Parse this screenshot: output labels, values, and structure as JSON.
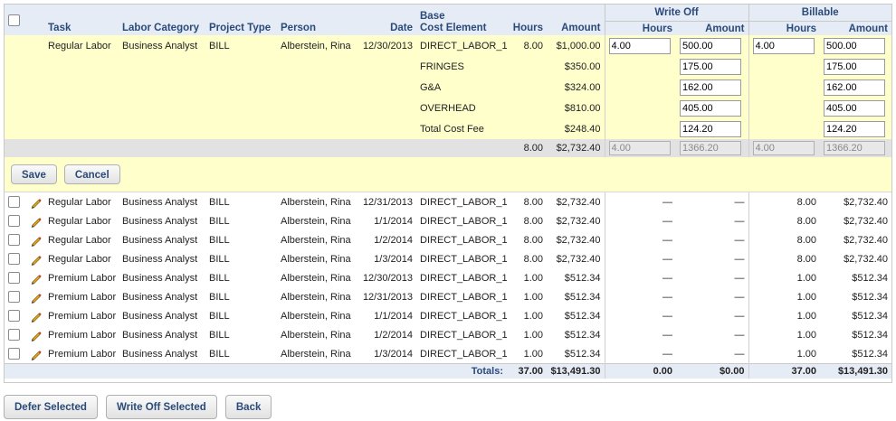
{
  "headers": {
    "task": "Task",
    "labor_category": "Labor Category",
    "project_type": "Project Type",
    "person": "Person",
    "date": "Date",
    "cost_element_1": "Base",
    "cost_element_2": "Cost Element",
    "hours": "Hours",
    "amount": "Amount",
    "write_off": "Write Off",
    "write_off_hours": "Hours",
    "write_off_amount": "Amount",
    "billable": "Billable",
    "billable_hours": "Hours",
    "billable_amount": "Amount"
  },
  "edit": {
    "task": "Regular Labor",
    "labor_category": "Business Analyst",
    "project_type": "BILL",
    "person": "Alberstein, Rina",
    "date": "12/30/2013",
    "rows": [
      {
        "cost_element": "DIRECT_LABOR_1",
        "hours": "8.00",
        "amount": "$1,000.00",
        "wo_hours": "4.00",
        "wo_amount": "500.00",
        "b_hours": "4.00",
        "b_amount": "500.00"
      },
      {
        "cost_element": "FRINGES",
        "hours": "",
        "amount": "$350.00",
        "wo_amount": "175.00",
        "b_amount": "175.00"
      },
      {
        "cost_element": "G&A",
        "hours": "",
        "amount": "$324.00",
        "wo_amount": "162.00",
        "b_amount": "162.00"
      },
      {
        "cost_element": "OVERHEAD",
        "hours": "",
        "amount": "$810.00",
        "wo_amount": "405.00",
        "b_amount": "405.00"
      },
      {
        "cost_element": "Total Cost Fee",
        "hours": "",
        "amount": "$248.40",
        "wo_amount": "124.20",
        "b_amount": "124.20"
      }
    ],
    "summary": {
      "hours": "8.00",
      "amount": "$2,732.40",
      "wo_hours": "4.00",
      "wo_amount": "1366.20",
      "b_hours": "4.00",
      "b_amount": "1366.20"
    },
    "save_label": "Save",
    "cancel_label": "Cancel"
  },
  "rows": [
    {
      "task": "Regular Labor",
      "labor_category": "Business Analyst",
      "project_type": "BILL",
      "person": "Alberstein, Rina",
      "date": "12/31/2013",
      "cost_element": "DIRECT_LABOR_1",
      "hours": "8.00",
      "amount": "$2,732.40",
      "wo_hours": "—",
      "wo_amount": "—",
      "b_hours": "8.00",
      "b_amount": "$2,732.40"
    },
    {
      "task": "Regular Labor",
      "labor_category": "Business Analyst",
      "project_type": "BILL",
      "person": "Alberstein, Rina",
      "date": "1/1/2014",
      "cost_element": "DIRECT_LABOR_1",
      "hours": "8.00",
      "amount": "$2,732.40",
      "wo_hours": "—",
      "wo_amount": "—",
      "b_hours": "8.00",
      "b_amount": "$2,732.40"
    },
    {
      "task": "Regular Labor",
      "labor_category": "Business Analyst",
      "project_type": "BILL",
      "person": "Alberstein, Rina",
      "date": "1/2/2014",
      "cost_element": "DIRECT_LABOR_1",
      "hours": "8.00",
      "amount": "$2,732.40",
      "wo_hours": "—",
      "wo_amount": "—",
      "b_hours": "8.00",
      "b_amount": "$2,732.40"
    },
    {
      "task": "Regular Labor",
      "labor_category": "Business Analyst",
      "project_type": "BILL",
      "person": "Alberstein, Rina",
      "date": "1/3/2014",
      "cost_element": "DIRECT_LABOR_1",
      "hours": "8.00",
      "amount": "$2,732.40",
      "wo_hours": "—",
      "wo_amount": "—",
      "b_hours": "8.00",
      "b_amount": "$2,732.40"
    },
    {
      "task": "Premium Labor",
      "labor_category": "Business Analyst",
      "project_type": "BILL",
      "person": "Alberstein, Rina",
      "date": "12/30/2013",
      "cost_element": "DIRECT_LABOR_1",
      "hours": "1.00",
      "amount": "$512.34",
      "wo_hours": "—",
      "wo_amount": "—",
      "b_hours": "1.00",
      "b_amount": "$512.34"
    },
    {
      "task": "Premium Labor",
      "labor_category": "Business Analyst",
      "project_type": "BILL",
      "person": "Alberstein, Rina",
      "date": "12/31/2013",
      "cost_element": "DIRECT_LABOR_1",
      "hours": "1.00",
      "amount": "$512.34",
      "wo_hours": "—",
      "wo_amount": "—",
      "b_hours": "1.00",
      "b_amount": "$512.34"
    },
    {
      "task": "Premium Labor",
      "labor_category": "Business Analyst",
      "project_type": "BILL",
      "person": "Alberstein, Rina",
      "date": "1/1/2014",
      "cost_element": "DIRECT_LABOR_1",
      "hours": "1.00",
      "amount": "$512.34",
      "wo_hours": "—",
      "wo_amount": "—",
      "b_hours": "1.00",
      "b_amount": "$512.34"
    },
    {
      "task": "Premium Labor",
      "labor_category": "Business Analyst",
      "project_type": "BILL",
      "person": "Alberstein, Rina",
      "date": "1/2/2014",
      "cost_element": "DIRECT_LABOR_1",
      "hours": "1.00",
      "amount": "$512.34",
      "wo_hours": "—",
      "wo_amount": "—",
      "b_hours": "1.00",
      "b_amount": "$512.34"
    },
    {
      "task": "Premium Labor",
      "labor_category": "Business Analyst",
      "project_type": "BILL",
      "person": "Alberstein, Rina",
      "date": "1/3/2014",
      "cost_element": "DIRECT_LABOR_1",
      "hours": "1.00",
      "amount": "$512.34",
      "wo_hours": "—",
      "wo_amount": "—",
      "b_hours": "1.00",
      "b_amount": "$512.34"
    }
  ],
  "totals": {
    "label": "Totals:",
    "hours": "37.00",
    "amount": "$13,491.30",
    "wo_hours": "0.00",
    "wo_amount": "$0.00",
    "b_hours": "37.00",
    "b_amount": "$13,491.30"
  },
  "footer": {
    "defer_label": "Defer Selected",
    "write_off_label": "Write Off Selected",
    "back_label": "Back"
  }
}
